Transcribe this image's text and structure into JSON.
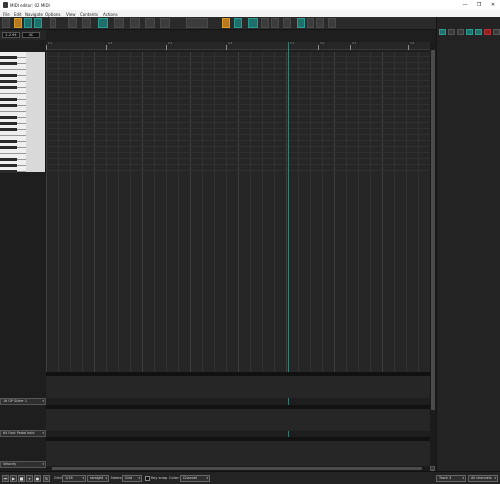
{
  "window": {
    "title": "MIDI editor: 02 MIDI",
    "controls": [
      "—",
      "❐",
      "✕"
    ]
  },
  "menu": [
    "File",
    "Edit",
    "Navigate",
    "Options",
    "View",
    "Contents",
    "Actions"
  ],
  "position": {
    "start": "2.2.94",
    "length": "4C"
  },
  "ruler": {
    "labels": [
      "2.1",
      "2.2",
      "2.3",
      "2.4",
      "3.1",
      "3.2",
      "3.3",
      "3.4"
    ]
  },
  "cc_lanes": [
    {
      "label": "16 GP Slider 1"
    },
    {
      "label": "64 Foot Pedal hold"
    },
    {
      "label": "Velocity"
    }
  ],
  "statusbar": {
    "grid_label": "Grid:",
    "grid_value": "1/16",
    "swing_value": "straight",
    "notes_label": "Notes:",
    "notes_value": "Grid",
    "keysnap_label": "Key snap",
    "color_label": "Color:",
    "color_value": "Channel",
    "track_value": "Track 3",
    "channels_value": "All channels"
  },
  "colors": {
    "accent": "#1f6f6a",
    "cursor": "#3d7a74",
    "background": "#262626"
  }
}
